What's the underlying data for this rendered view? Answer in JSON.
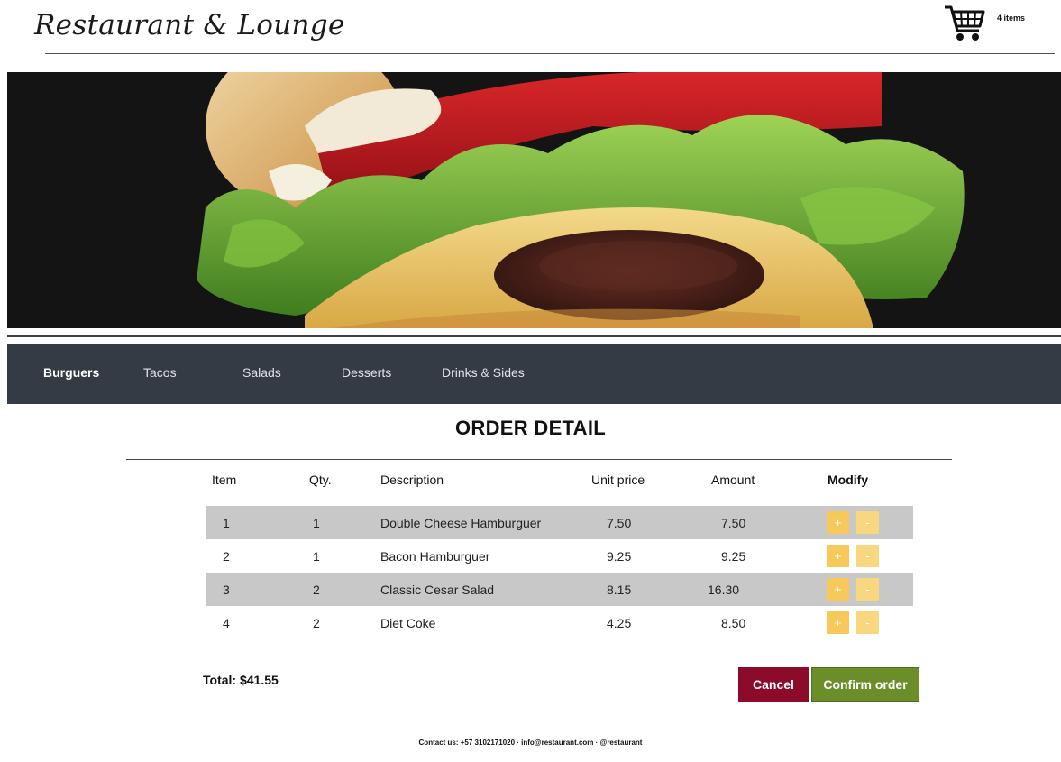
{
  "header": {
    "brand": "Restaurant & Lounge",
    "cart_count": "4 items"
  },
  "nav": {
    "items": [
      {
        "label": "Burguers",
        "active": true
      },
      {
        "label": "Tacos",
        "active": false
      },
      {
        "label": "Salads",
        "active": false
      },
      {
        "label": "Desserts",
        "active": false
      },
      {
        "label": "Drinks & Sides",
        "active": false
      }
    ]
  },
  "order": {
    "title": "ORDER DETAIL",
    "columns": [
      "Item",
      "Qty.",
      "Description",
      "Unit price",
      "Amount",
      "Modify"
    ],
    "rows": [
      {
        "item": "1",
        "qty": "1",
        "description": "Double Cheese Hamburguer",
        "unit_price": "7.50",
        "amount": "7.50",
        "plus": "+",
        "minus": "-"
      },
      {
        "item": "2",
        "qty": "1",
        "description": "Bacon Hamburguer",
        "unit_price": "9.25",
        "amount": "9.25",
        "plus": "+",
        "minus": "-"
      },
      {
        "item": "3",
        "qty": "2",
        "description": "Classic Cesar Salad",
        "unit_price": "8.15",
        "amount": "16.30",
        "plus": "+",
        "minus": "-"
      },
      {
        "item": "4",
        "qty": "2",
        "description": "Diet Coke",
        "unit_price": "4.25",
        "amount": "8.50",
        "plus": "+",
        "minus": "-"
      }
    ],
    "total": "Total: $41.55"
  },
  "actions": {
    "cancel": "Cancel",
    "confirm": "Confirm order"
  },
  "footer": {
    "contact": "Contact us: +57 3102171020 · info@restaurant.com · @restaurant"
  },
  "colors": {
    "nav_bg": "#343b44",
    "cancel": "#8c0b2b",
    "confirm": "#6b8e2a",
    "modify_button": "#f7c95a"
  },
  "icons": {
    "cart": "shopping-cart-icon"
  }
}
